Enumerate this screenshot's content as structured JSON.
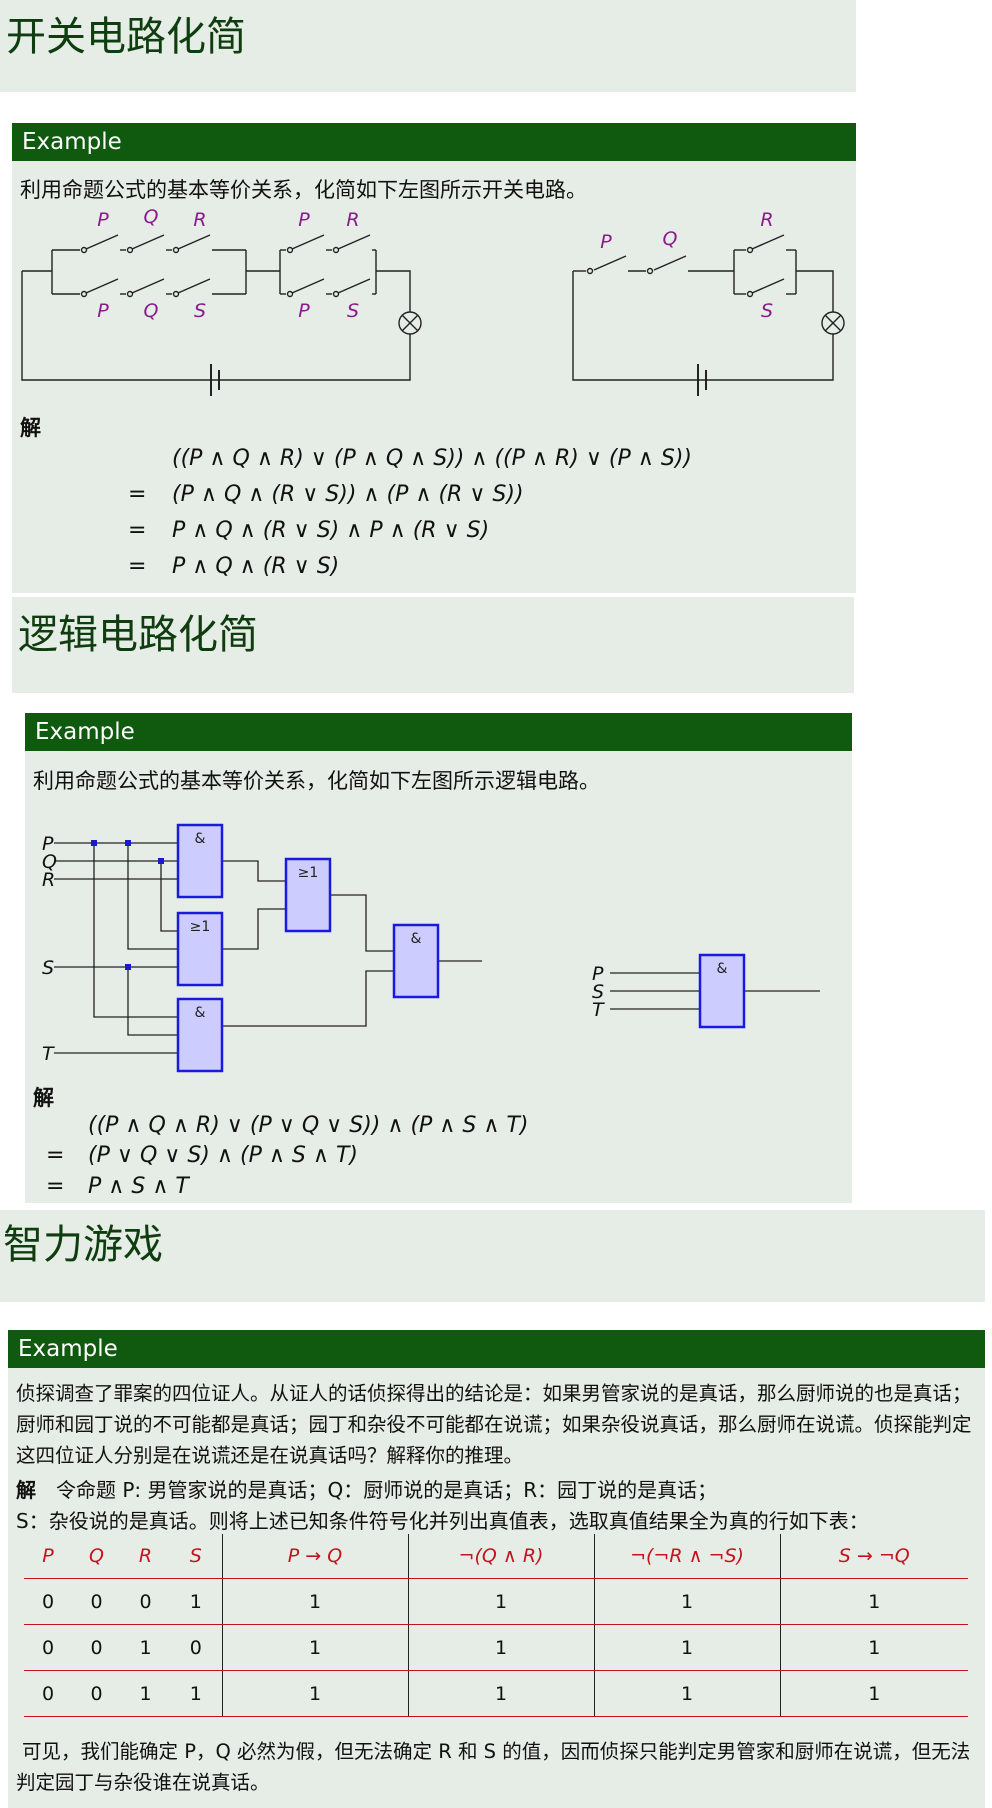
{
  "frames": [
    {
      "title": "开关电路化简",
      "example_label": "Example",
      "problem": "利用命题公式的基本等价关系，化简如下左图所示开关电路。",
      "solution_label": "解",
      "derivation": [
        {
          "op": "",
          "expr": "((P ∧ Q ∧ R) ∨ (P ∧ Q ∧ S)) ∧ ((P ∧ R) ∨ (P ∧ S))"
        },
        {
          "op": "=",
          "expr": "(P ∧ Q ∧ (R ∨ S)) ∧ (P ∧ (R ∨ S))"
        },
        {
          "op": "=",
          "expr": "P ∧ Q ∧ (R ∨ S) ∧ P ∧ (R ∨ S)"
        },
        {
          "op": "=",
          "expr": "P ∧ Q ∧ (R ∨ S)"
        }
      ],
      "left_circuit_labels": {
        "top": [
          "P",
          "Q",
          "R",
          "P",
          "R"
        ],
        "bottom": [
          "P",
          "Q",
          "S",
          "P",
          "S"
        ]
      },
      "right_circuit_labels": {
        "series": [
          "P",
          "Q"
        ],
        "top": "R",
        "bottom": "S"
      }
    },
    {
      "title": "逻辑电路化简",
      "example_label": "Example",
      "problem": "利用命题公式的基本等价关系，化简如下左图所示逻辑电路。",
      "solution_label": "解",
      "inputs_left": [
        "P",
        "Q",
        "R",
        "S",
        "T"
      ],
      "inputs_right": [
        "P",
        "S",
        "T"
      ],
      "gates": {
        "and": "&",
        "or": "≥1"
      },
      "derivation": [
        {
          "op": "",
          "expr": "((P ∧ Q ∧ R) ∨ (P ∨ Q ∨ S)) ∧ (P ∧ S ∧ T)"
        },
        {
          "op": "=",
          "expr": "(P ∨ Q ∨ S) ∧ (P ∧ S ∧ T)"
        },
        {
          "op": "=",
          "expr": "P ∧ S ∧ T"
        }
      ]
    },
    {
      "title": "智力游戏",
      "example_label": "Example",
      "problem": "侦探调查了罪案的四位证人。从证人的话侦探得出的结论是：如果男管家说的是真话，那么厨师说的也是真话；厨师和园丁说的不可能都是真话；园丁和杂役不可能都在说谎；如果杂役说真话，那么厨师在说谎。侦探能判定这四位证人分别是在说谎还是在说真话吗？解释你的推理。",
      "solution_label": "解",
      "solution_line1": "令命题 P: 男管家说的是真话；Q：厨师说的是真话；R：园丁说的是真话；",
      "solution_line2": "S：杂役说的是真话。则将上述已知条件符号化并列出真值表，选取真值结果全为真的行如下表：",
      "table": {
        "headers": [
          "P",
          "Q",
          "R",
          "S",
          "P → Q",
          "¬(Q ∧ R)",
          "¬(¬R ∧ ¬S)",
          "S → ¬Q"
        ],
        "rows": [
          [
            "0",
            "0",
            "0",
            "1",
            "1",
            "1",
            "1",
            "1"
          ],
          [
            "0",
            "0",
            "1",
            "0",
            "1",
            "1",
            "1",
            "1"
          ],
          [
            "0",
            "0",
            "1",
            "1",
            "1",
            "1",
            "1",
            "1"
          ]
        ]
      },
      "conclusion": "可见，我们能确定 P，Q 必然为假，但无法确定 R 和 S 的值，因而侦探只能判定男管家和厨师在说谎，但无法判定园丁与杂役谁在说真话。"
    }
  ]
}
